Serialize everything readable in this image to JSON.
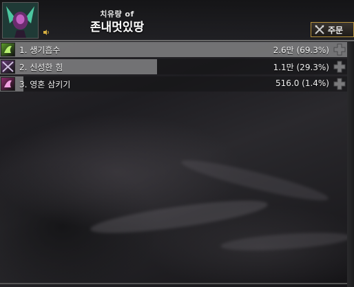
{
  "header": {
    "title_small": "치유량 of",
    "title_name": "존내멋있땅",
    "order_button_label": "주문"
  },
  "rows": [
    {
      "rank_label": "1. 생기흡수",
      "value": "2.6만 (69.3%)",
      "percent": 69.3,
      "icon": "life-drain-icon",
      "icon_color": "#5a9a2a"
    },
    {
      "rank_label": "2. 신성한 힘",
      "value": "1.1만 (29.3%)",
      "percent": 29.3,
      "icon": "holy-power-icon",
      "icon_color": "#6a3f7a"
    },
    {
      "rank_label": "3. 영혼 삼키기",
      "value": "516.0 (1.4%)",
      "percent": 1.4,
      "icon": "soul-swallow-icon",
      "icon_color": "#8a2a6a"
    }
  ],
  "colors": {
    "accent_border": "#b7923c",
    "bar_fill": "#828284"
  }
}
